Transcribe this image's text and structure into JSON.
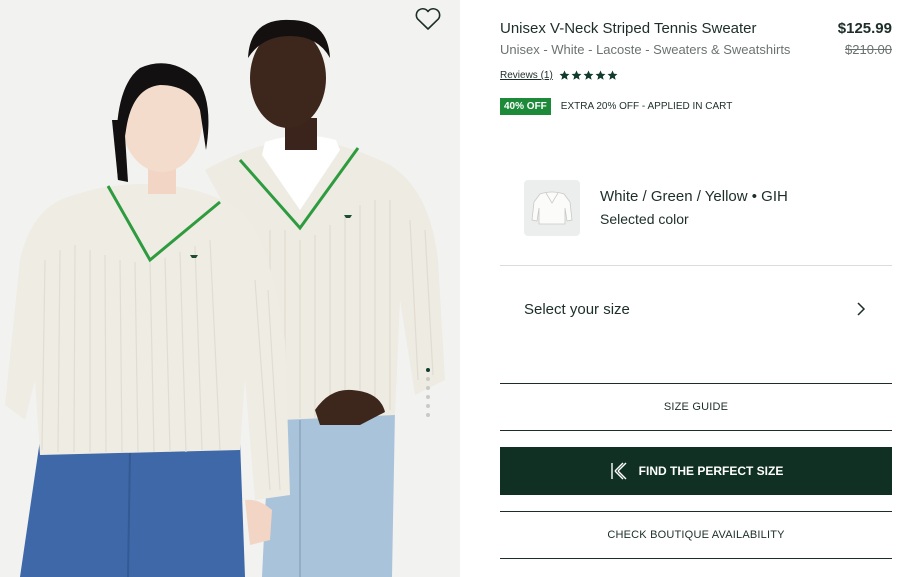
{
  "product": {
    "title": "Unisex V-Neck Striped Tennis Sweater",
    "subtitle": "Unisex - White - Lacoste - Sweaters & Sweatshirts",
    "price": "$125.99",
    "original_price": "$210.00"
  },
  "reviews": {
    "link_label": "Reviews (1)",
    "rating": 5,
    "max_rating": 5
  },
  "promo": {
    "badge": "40% OFF",
    "text": "EXTRA 20% OFF - APPLIED IN CART"
  },
  "color": {
    "name": "White / Green / Yellow • GIH",
    "caption": "Selected color"
  },
  "size": {
    "select_label": "Select your size",
    "guide_label": "SIZE GUIDE",
    "find_label": "FIND THE PERFECT SIZE"
  },
  "boutique": {
    "label": "CHECK BOUTIQUE AVAILABILITY"
  },
  "gallery": {
    "total_images": 6,
    "active_index": 0
  },
  "colors": {
    "brand_dark": "#0f3022",
    "badge_green": "#1d8a3a",
    "trim_green": "#2e9b3f",
    "sweater_cream": "#efece4"
  },
  "icons": {
    "wishlist": "heart-outline-icon",
    "size_chevron": "chevron-right-icon",
    "find_size": "kiwisizing-logo-icon",
    "star": "star-filled-icon"
  }
}
